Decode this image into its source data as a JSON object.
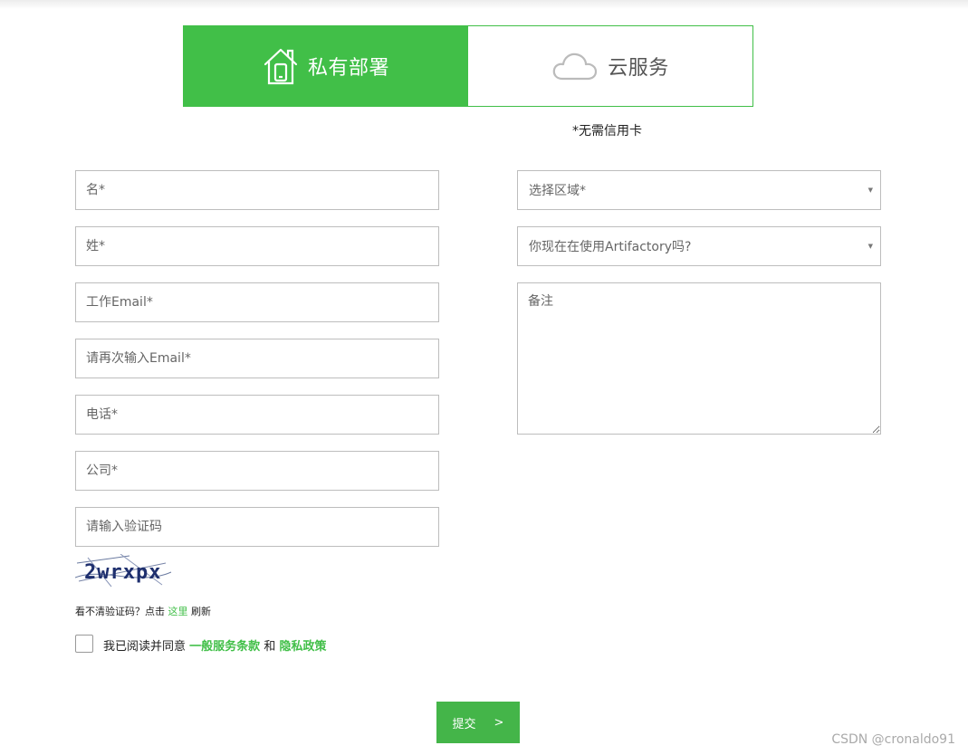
{
  "tabs": {
    "private": {
      "label": "私有部署",
      "icon": "house-icon"
    },
    "cloud": {
      "label": "云服务",
      "icon": "cloud-icon"
    }
  },
  "note": "*无需信用卡",
  "form": {
    "first_name": "名*",
    "last_name": "姓*",
    "work_email": "工作Email*",
    "confirm_email": "请再次输入Email*",
    "phone": "电话*",
    "company": "公司*",
    "captcha_input": "请输入验证码",
    "region_select": "选择区域*",
    "artifactory_select": "你现在在使用Artifactory吗?",
    "remarks": "备注"
  },
  "captcha": {
    "code": "2wrxpx",
    "hint_prefix": "看不清验证码？点击",
    "hint_link": "这里",
    "hint_suffix": "刷新"
  },
  "agreement": {
    "prefix": "我已阅读并同意",
    "terms": "一般服务条款",
    "and": "和",
    "privacy": "隐私政策"
  },
  "submit": {
    "label": "提交",
    "arrow": ">"
  },
  "watermark": "CSDN @cronaldo91",
  "colors": {
    "accent": "#41bf48",
    "border": "#bdbdbd"
  }
}
